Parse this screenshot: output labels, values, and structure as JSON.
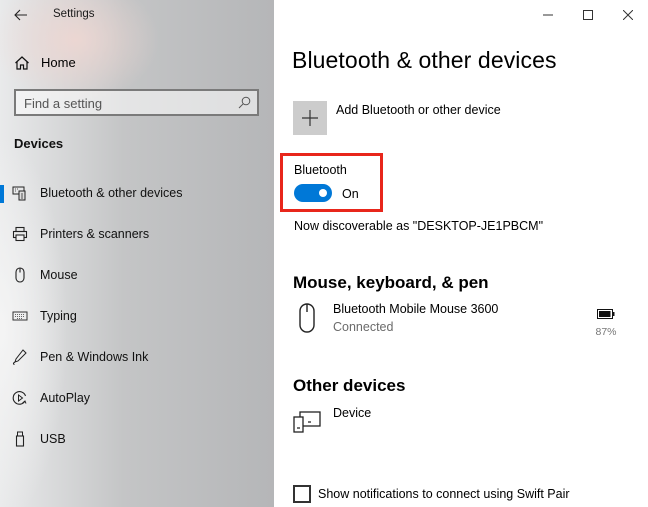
{
  "window": {
    "title": "Settings",
    "controls": {
      "minimize": "minimize",
      "maximize": "maximize",
      "close": "close"
    }
  },
  "sidebar": {
    "home_label": "Home",
    "search": {
      "placeholder": "Find a setting",
      "value": ""
    },
    "section_header": "Devices",
    "items": [
      {
        "label": "Bluetooth & other devices",
        "icon": "bluetooth-devices-icon",
        "active": true
      },
      {
        "label": "Printers & scanners",
        "icon": "printer-icon",
        "active": false
      },
      {
        "label": "Mouse",
        "icon": "mouse-icon",
        "active": false
      },
      {
        "label": "Typing",
        "icon": "keyboard-icon",
        "active": false
      },
      {
        "label": "Pen & Windows Ink",
        "icon": "pen-icon",
        "active": false
      },
      {
        "label": "AutoPlay",
        "icon": "autoplay-icon",
        "active": false
      },
      {
        "label": "USB",
        "icon": "usb-icon",
        "active": false
      }
    ]
  },
  "main": {
    "title": "Bluetooth & other devices",
    "add_device_label": "Add Bluetooth or other device",
    "bluetooth": {
      "label": "Bluetooth",
      "state": "On",
      "enabled": true,
      "discoverable_text": "Now discoverable as \"DESKTOP-JE1PBCM\""
    },
    "sections": {
      "mouse_keyboard_pen": {
        "title": "Mouse, keyboard, & pen",
        "devices": [
          {
            "name": "Bluetooth Mobile Mouse 3600",
            "status": "Connected",
            "battery": "87%",
            "icon": "mouse-icon"
          }
        ]
      },
      "other_devices": {
        "title": "Other devices",
        "devices": [
          {
            "name": "Device",
            "icon": "device-icon"
          }
        ]
      }
    },
    "swift_pair": {
      "label": "Show notifications to connect using Swift Pair",
      "checked": false
    }
  },
  "colors": {
    "accent": "#0078d7",
    "highlight_border": "#e8261b",
    "add_button_bg": "#cccccc"
  }
}
